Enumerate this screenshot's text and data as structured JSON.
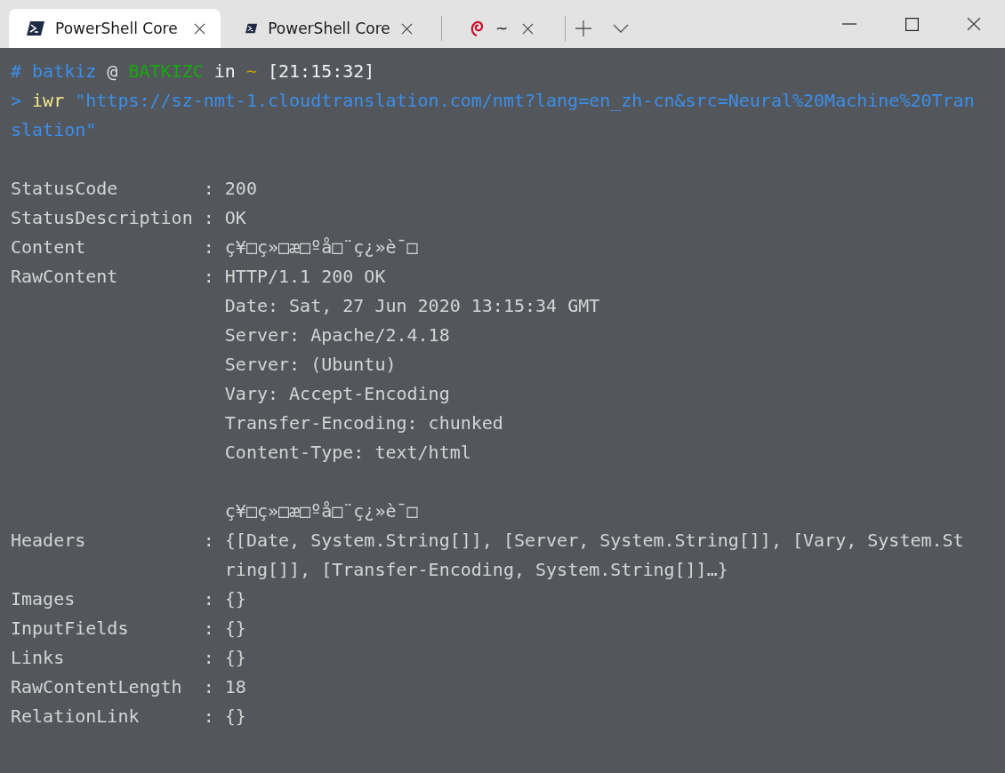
{
  "tabs": [
    {
      "title": "PowerShell Core",
      "kind": "shell",
      "selected": true
    },
    {
      "title": "PowerShell Core",
      "kind": "shell",
      "selected": false
    },
    {
      "title": "~",
      "kind": "swirl",
      "selected": false
    }
  ],
  "prompt": {
    "hash": "#",
    "user": "batkiz",
    "at": "@",
    "host": "BATKIZC",
    "in": "in",
    "dir": "~",
    "time": "[21:15:32]"
  },
  "command": {
    "marker": ">",
    "name": "iwr",
    "argument_lines": [
      "\"https://sz-nmt-1.cloudtranslation.com/nmt?lang=en_zh-cn&src=Neural%20Machine%20Tran",
      "slation\""
    ]
  },
  "output": [
    {
      "key": "StatusCode",
      "separator": ":",
      "value_blocks": [
        [
          "200"
        ]
      ]
    },
    {
      "key": "StatusDescription",
      "separator": ":",
      "value_blocks": [
        [
          "OK"
        ]
      ]
    },
    {
      "key": "Content",
      "separator": ":",
      "value_blocks": [
        [
          "ç¥□ç»□æ□ºå□¨ç¿»è¯□"
        ]
      ]
    },
    {
      "key": "RawContent",
      "separator": ":",
      "value_blocks": [
        [
          "HTTP/1.1 200 OK",
          "Date: Sat, 27 Jun 2020 13:15:34 GMT",
          "Server: Apache/2.4.18",
          "Server: (Ubuntu)",
          "Vary: Accept-Encoding",
          "Transfer-Encoding: chunked",
          "Content-Type: text/html"
        ],
        [
          "ç¥□ç»□æ□ºå□¨ç¿»è¯□"
        ]
      ]
    },
    {
      "key": "Headers",
      "separator": ":",
      "value_blocks": [
        [
          "{[Date, System.String[]], [Server, System.String[]], [Vary, System.St",
          "ring[]], [Transfer-Encoding, System.String[]]…}"
        ]
      ]
    },
    {
      "key": "Images",
      "separator": ":",
      "value_blocks": [
        [
          "{}"
        ]
      ]
    },
    {
      "key": "InputFields",
      "separator": ":",
      "value_blocks": [
        [
          "{}"
        ]
      ]
    },
    {
      "key": "Links",
      "separator": ":",
      "value_blocks": [
        [
          "{}"
        ]
      ]
    },
    {
      "key": "RawContentLength",
      "separator": ":",
      "value_blocks": [
        [
          "18"
        ]
      ]
    },
    {
      "key": "RelationLink",
      "separator": ":",
      "value_blocks": [
        [
          "{}"
        ]
      ]
    }
  ]
}
